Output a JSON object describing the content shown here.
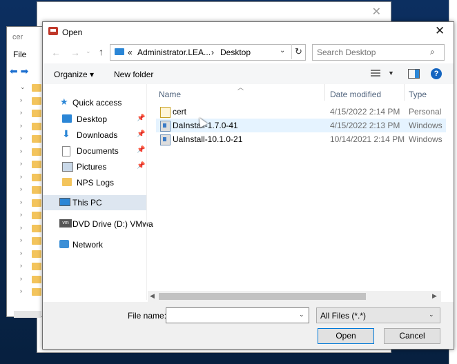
{
  "background": {
    "explorer": {
      "title": "cer",
      "menu_file": "File"
    }
  },
  "dialog": {
    "title": "Open",
    "address": {
      "crumbs": [
        "«",
        "Administrator.LEA...",
        "›",
        "Desktop"
      ]
    },
    "search": {
      "placeholder": "Search Desktop"
    },
    "toolbar": {
      "organize": "Organize ▾",
      "new_folder": "New folder"
    },
    "nav_pane": {
      "quick_access": "Quick access",
      "items": [
        {
          "label": "Desktop",
          "icon": "desktop-icon",
          "pinned": true
        },
        {
          "label": "Downloads",
          "icon": "downloads-icon",
          "pinned": true
        },
        {
          "label": "Documents",
          "icon": "documents-icon",
          "pinned": true
        },
        {
          "label": "Pictures",
          "icon": "pictures-icon",
          "pinned": true
        },
        {
          "label": "NPS Logs",
          "icon": "folder-icon",
          "pinned": false
        }
      ],
      "this_pc": "This PC",
      "dvd": "DVD Drive (D:) VMwa",
      "network": "Network"
    },
    "columns": {
      "name": "Name",
      "date": "Date modified",
      "type": "Type"
    },
    "files": [
      {
        "name": "cert",
        "date": "4/15/2022 2:14 PM",
        "type": "Personal Info",
        "icon": "certificate-icon"
      },
      {
        "name": "DaInstall-1.7.0-41",
        "date": "4/15/2022 2:13 PM",
        "type": "Windows Ins",
        "icon": "installer-icon"
      },
      {
        "name": "UaInstall-10.1.0-21",
        "date": "10/14/2021 2:14 PM",
        "type": "Windows Ins",
        "icon": "installer-icon"
      }
    ],
    "file_name_label": "File name:",
    "file_name_value": "",
    "file_type": "All Files (*.*)",
    "open_button": "Open",
    "cancel_button": "Cancel",
    "colors": {
      "accent": "#0078d7",
      "selection": "#dde6f0",
      "hover_row": "#e5f3ff"
    }
  }
}
